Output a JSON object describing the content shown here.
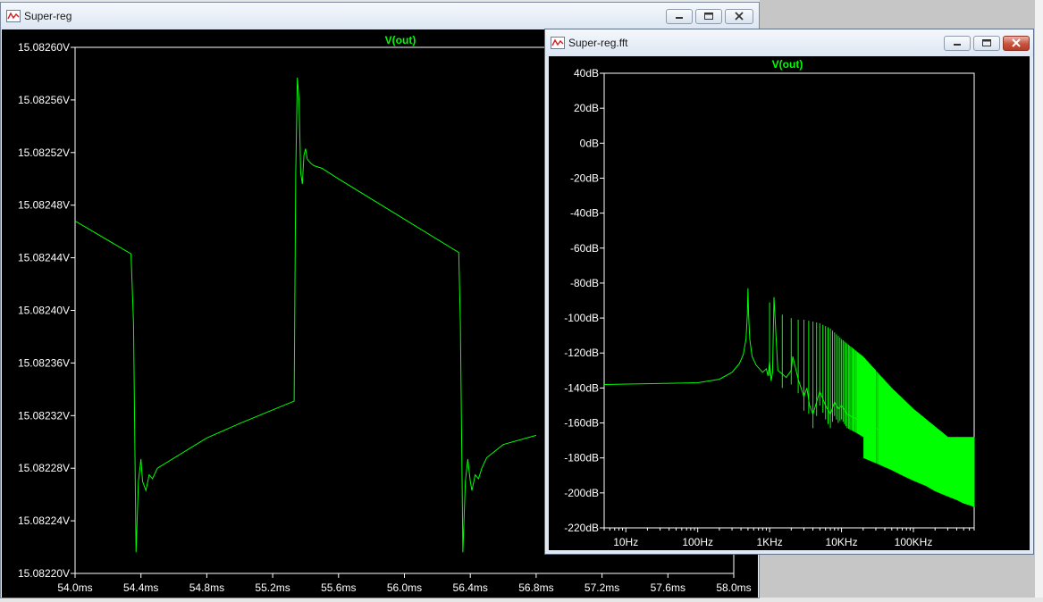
{
  "window_main": {
    "title": "Super-reg",
    "trace_label": "V(out)",
    "trace_color": "#00ff00",
    "chart_data": {
      "type": "line",
      "title": "V(out)",
      "xlabel": "",
      "ylabel": "",
      "x_unit": "ms",
      "y_unit": "V",
      "xlim": [
        54.0,
        58.0
      ],
      "ylim": [
        15.0822,
        15.0826
      ],
      "x_ticks": [
        54.0,
        54.4,
        54.8,
        55.2,
        55.6,
        56.0,
        56.4,
        56.8,
        57.2,
        57.6,
        58.0
      ],
      "x_tick_labels": [
        "54.0ms",
        "54.4ms",
        "54.8ms",
        "55.2ms",
        "55.6ms",
        "56.0ms",
        "56.4ms",
        "56.8ms",
        "57.2ms",
        "57.6ms",
        "58.0ms"
      ],
      "y_ticks": [
        15.0822,
        15.08224,
        15.08228,
        15.08232,
        15.08236,
        15.0824,
        15.08244,
        15.08248,
        15.08252,
        15.08256,
        15.0826
      ],
      "y_tick_labels": [
        "15.08220V",
        "15.08224V",
        "15.08228V",
        "15.08232V",
        "15.08236V",
        "15.08240V",
        "15.08244V",
        "15.08248V",
        "15.08252V",
        "15.08256V",
        "15.08260V"
      ],
      "grid": false,
      "series": [
        {
          "x": [
            54.0,
            54.34,
            54.355,
            54.37,
            54.385,
            54.4,
            54.41,
            54.43,
            54.45,
            54.47,
            54.5,
            54.8,
            55.0,
            55.33,
            55.34,
            55.35,
            55.36,
            55.37,
            55.38,
            55.39,
            55.4,
            55.41,
            55.43,
            55.45,
            55.5,
            55.6,
            56.33,
            56.34,
            56.355,
            56.37,
            56.385,
            56.4,
            56.41,
            56.43,
            56.45,
            56.47,
            56.5,
            56.6,
            56.8
          ],
          "y": [
            15.082468,
            15.082443,
            15.08239,
            15.082216,
            15.08227,
            15.082287,
            15.08227,
            15.082263,
            15.082275,
            15.082272,
            15.08228,
            15.082303,
            15.082314,
            15.082331,
            15.082504,
            15.082577,
            15.08256,
            15.082505,
            15.082496,
            15.082518,
            15.082523,
            15.082515,
            15.082512,
            15.08251,
            15.082508,
            15.0825,
            15.082444,
            15.08239,
            15.082216,
            15.08227,
            15.082287,
            15.08227,
            15.082263,
            15.082275,
            15.082272,
            15.08228,
            15.082288,
            15.082298,
            15.082305
          ]
        }
      ]
    }
  },
  "window_fft": {
    "title": "Super-reg.fft",
    "trace_label": "V(out)",
    "trace_color": "#00ff00",
    "chart_data": {
      "type": "line",
      "title": "V(out)",
      "xlabel": "",
      "ylabel": "",
      "x_scale": "log",
      "x_unit": "Hz",
      "y_unit": "dB",
      "xlim": [
        5,
        700000
      ],
      "ylim": [
        -220,
        40
      ],
      "x_ticks": [
        10,
        100,
        1000,
        10000,
        100000
      ],
      "x_tick_labels": [
        "10Hz",
        "100Hz",
        "1KHz",
        "10KHz",
        "100KHz"
      ],
      "y_ticks": [
        40,
        20,
        0,
        -20,
        -40,
        -60,
        -80,
        -100,
        -120,
        -140,
        -160,
        -180,
        -200,
        -220
      ],
      "y_tick_labels": [
        "40dB",
        "20dB",
        "0dB",
        "-20dB",
        "-40dB",
        "-60dB",
        "-80dB",
        "-100dB",
        "-120dB",
        "-140dB",
        "-160dB",
        "-180dB",
        "-200dB",
        "-220dB"
      ],
      "grid": false,
      "series": [
        {
          "x": [
            5,
            100,
            200,
            300,
            380,
            430,
            470,
            490,
            500,
            510,
            530,
            570,
            650,
            800,
            900,
            950,
            1000,
            1050,
            1100,
            1150,
            1300,
            1500,
            1700,
            2000,
            2100,
            2500,
            3000,
            3300,
            3600,
            4000,
            4500,
            5000,
            6000,
            7000,
            8000,
            9000,
            10000,
            12000,
            15000,
            20000,
            30000,
            50000,
            70000,
            100000,
            150000,
            200000,
            300000,
            400000,
            500000,
            600000,
            700000
          ],
          "y": [
            -138,
            -137,
            -135,
            -131,
            -126,
            -121,
            -112,
            -98,
            -83,
            -98,
            -112,
            -122,
            -127,
            -131,
            -129,
            -133,
            -125,
            -136,
            -131,
            -88,
            -130,
            -132,
            -134,
            -130,
            -122,
            -135,
            -145,
            -140,
            -150,
            -155,
            -148,
            -142,
            -150,
            -155,
            -148,
            -152,
            -150,
            -155,
            -157,
            -160,
            -163,
            -167,
            -170,
            -173,
            -176,
            -179,
            -182,
            -184,
            -186,
            -187,
            -188
          ]
        }
      ],
      "peaks": [
        {
          "f": 500,
          "dB": -83
        },
        {
          "f": 1000,
          "dB": -91
        },
        {
          "f": 1500,
          "dB": -98
        },
        {
          "f": 2000,
          "dB": -100
        },
        {
          "f": 2500,
          "dB": -101
        },
        {
          "f": 3000,
          "dB": -101
        },
        {
          "f": 4000,
          "dB": -102
        },
        {
          "f": 5000,
          "dB": -103
        },
        {
          "f": 7000,
          "dB": -106
        },
        {
          "f": 10000,
          "dB": -112
        },
        {
          "f": 20000,
          "dB": -122
        },
        {
          "f": 50000,
          "dB": -140
        },
        {
          "f": 100000,
          "dB": -152
        },
        {
          "f": 300000,
          "dB": -168
        }
      ]
    }
  }
}
